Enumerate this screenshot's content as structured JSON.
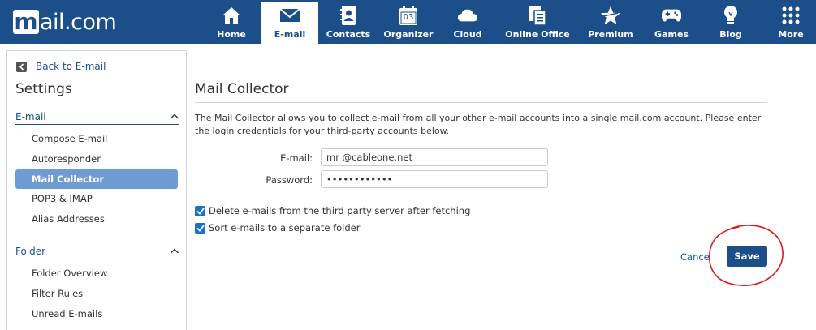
{
  "brand": {
    "logo_letter": "m",
    "logo_text": "ail.com"
  },
  "nav": [
    {
      "label": "Home",
      "icon": "home-icon"
    },
    {
      "label": "E-mail",
      "icon": "envelope-icon",
      "active": true
    },
    {
      "label": "Contacts",
      "icon": "contacts-icon"
    },
    {
      "label": "Organizer",
      "icon": "calendar-icon",
      "calendar_day": "03"
    },
    {
      "label": "Cloud",
      "icon": "cloud-icon"
    },
    {
      "label": "Online Office",
      "icon": "office-icon"
    },
    {
      "label": "Premium",
      "icon": "star-icon"
    },
    {
      "label": "Games",
      "icon": "gamepad-icon"
    },
    {
      "label": "Blog",
      "icon": "bulb-icon"
    },
    {
      "label": "More",
      "icon": "grid-icon"
    }
  ],
  "sidebar": {
    "back_label": "Back to E-mail",
    "title": "Settings",
    "sections": [
      {
        "heading": "E-mail",
        "items": [
          "Compose E-mail",
          "Autoresponder",
          "Mail Collector",
          "POP3 & IMAP",
          "Alias Addresses"
        ],
        "active_item": "Mail Collector"
      },
      {
        "heading": "Folder",
        "items": [
          "Folder Overview",
          "Filter Rules",
          "Unread E-mails"
        ]
      }
    ]
  },
  "main": {
    "title": "Mail Collector",
    "description": "The Mail Collector allows you to collect e-mail from all your other e-mail accounts into a single mail.com account. Please enter the login credentials for your third-party accounts below.",
    "email_label": "E-mail:",
    "email_value": "mr              @cableone.net",
    "password_label": "Password:",
    "password_value": "••••••••••••",
    "option_delete": "Delete e-mails from the third party server after fetching",
    "option_sort": "Sort e-mails to a separate folder",
    "cancel_label": "Cance",
    "save_label": "Save"
  },
  "colors": {
    "brand_blue": "#1c4f8a",
    "active_item_bg": "#6f9bd3",
    "checkbox_blue": "#1a73c7",
    "annotation_red": "#e0141e"
  }
}
